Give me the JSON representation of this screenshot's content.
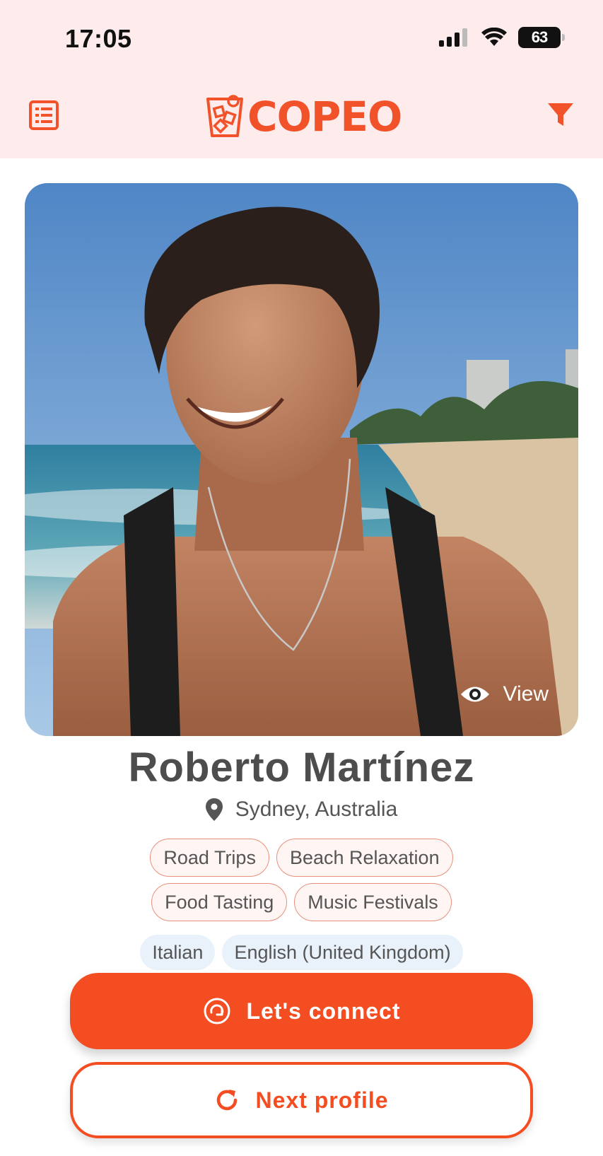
{
  "status_bar": {
    "time": "17:05",
    "battery": "63"
  },
  "header": {
    "logo_text": "COPEO",
    "menu_icon": "list-icon",
    "filter_icon": "filter-icon"
  },
  "profile": {
    "view_label": "View",
    "name": "Roberto Martínez",
    "location": "Sydney, Australia",
    "interests": [
      "Road Trips",
      "Beach Relaxation",
      "Food Tasting",
      "Music Festivals"
    ],
    "languages": [
      "Italian",
      "English (United Kingdom)"
    ]
  },
  "actions": {
    "connect_label": "Let's connect",
    "next_label": "Next profile"
  },
  "colors": {
    "accent": "#f44d22",
    "header_bg": "#fdeceb",
    "chip_border": "#e9907b",
    "lang_chip_bg": "#e9f2fb"
  }
}
